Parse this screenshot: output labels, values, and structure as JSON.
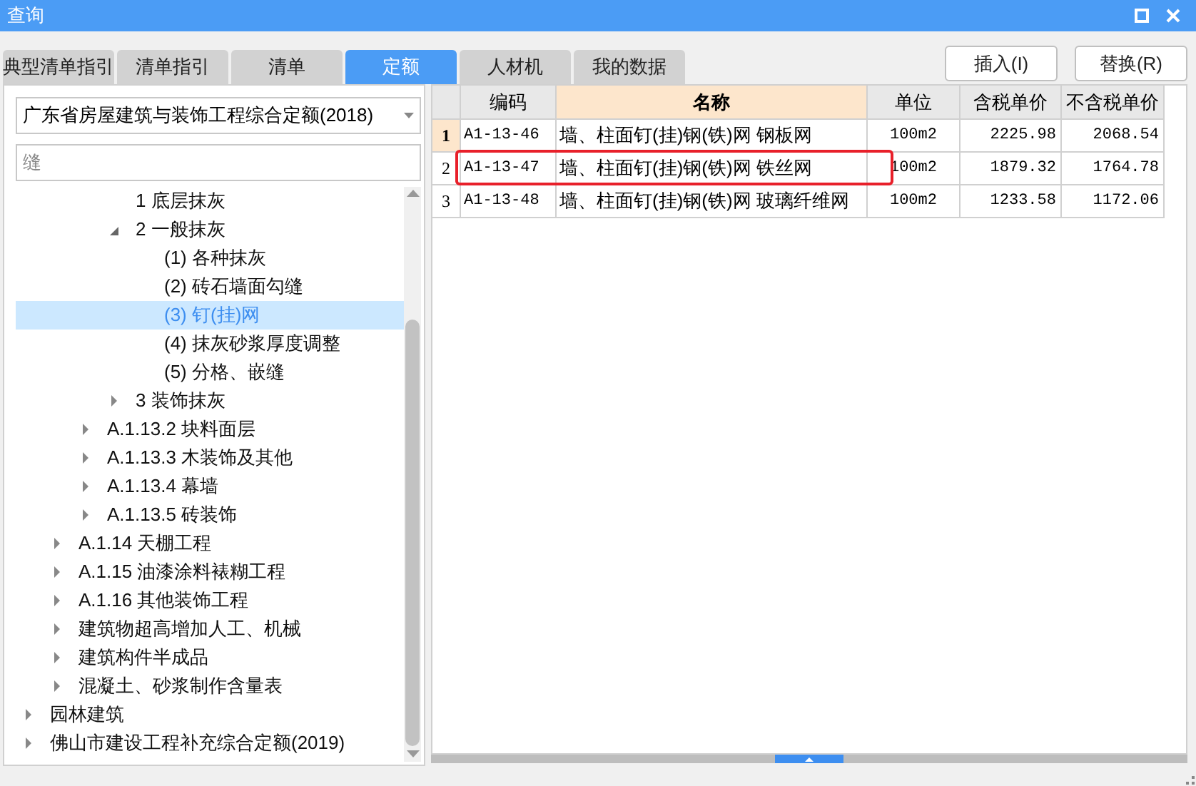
{
  "window": {
    "title": "查询"
  },
  "tabs": [
    {
      "label": "典型清单指引",
      "selected": false
    },
    {
      "label": "清单指引",
      "selected": false
    },
    {
      "label": "清单",
      "selected": false
    },
    {
      "label": "定额",
      "selected": true
    },
    {
      "label": "人材机",
      "selected": false
    },
    {
      "label": "我的数据",
      "selected": false
    }
  ],
  "buttons": [
    "插入(I)",
    "替换(R)"
  ],
  "library_select": {
    "value": "广东省房屋建筑与装饰工程综合定额(2018)"
  },
  "search": {
    "value": "缝"
  },
  "tree": [
    {
      "children": [
        {
          "children": [
            {
              "children": [
                {
                  "label": "1 底层抹灰",
                  "selected": false
                },
                {
                  "label": "2 一般抹灰",
                  "selected": false,
                  "expanded": true,
                  "children": [
                    {
                      "label": "(1) 各种抹灰",
                      "selected": false
                    },
                    {
                      "label": "(2) 砖石墙面勾缝",
                      "selected": false
                    },
                    {
                      "label": "(3) 钉(挂)网",
                      "selected": true
                    },
                    {
                      "label": "(4) 抹灰砂浆厚度调整",
                      "selected": false
                    },
                    {
                      "label": "(5) 分格、嵌缝",
                      "selected": false
                    }
                  ]
                },
                {
                  "label": "3 装饰抹灰",
                  "selected": false,
                  "expanded": false
                }
              ]
            },
            {
              "label": "A.1.13.2 块料面层",
              "selected": false,
              "expanded": false
            },
            {
              "label": "A.1.13.3 木装饰及其他",
              "selected": false,
              "expanded": false
            },
            {
              "label": "A.1.13.4 幕墙",
              "selected": false,
              "expanded": false
            },
            {
              "label": "A.1.13.5 砖装饰",
              "selected": false,
              "expanded": false
            }
          ]
        },
        {
          "label": "A.1.14 天棚工程",
          "selected": false,
          "expanded": false
        },
        {
          "label": "A.1.15 油漆涂料裱糊工程",
          "selected": false,
          "expanded": false
        },
        {
          "label": "A.1.16 其他装饰工程",
          "selected": false,
          "expanded": false
        },
        {
          "label": "建筑物超高增加人工、机械",
          "selected": false,
          "expanded": false
        },
        {
          "label": "建筑构件半成品",
          "selected": false,
          "expanded": false
        },
        {
          "label": "混凝土、砂浆制作含量表",
          "selected": false,
          "expanded": false
        }
      ]
    },
    {
      "label": "园林建筑",
      "selected": false,
      "expanded": false
    },
    {
      "label": "佛山市建设工程补充综合定额(2019)",
      "selected": false,
      "expanded": false
    }
  ],
  "table": {
    "columns": [
      "编码",
      "名称",
      "单位",
      "含税单价",
      "不含税单价"
    ],
    "rows": [
      {
        "index": "1",
        "selected": true,
        "highlighted": false,
        "cells": [
          "A1-13-46",
          "墙、柱面钉(挂)钢(铁)网 钢板网",
          "100m2",
          "2225.98",
          "2068.54"
        ]
      },
      {
        "index": "2",
        "selected": false,
        "highlighted": true,
        "cells": [
          "A1-13-47",
          "墙、柱面钉(挂)钢(铁)网 铁丝网",
          "100m2",
          "1879.32",
          "1764.78"
        ]
      },
      {
        "index": "3",
        "selected": false,
        "highlighted": false,
        "cells": [
          "A1-13-48",
          "墙、柱面钉(挂)钢(铁)网 玻璃纤维网",
          "100m2",
          "1233.58",
          "1172.06"
        ]
      }
    ]
  }
}
